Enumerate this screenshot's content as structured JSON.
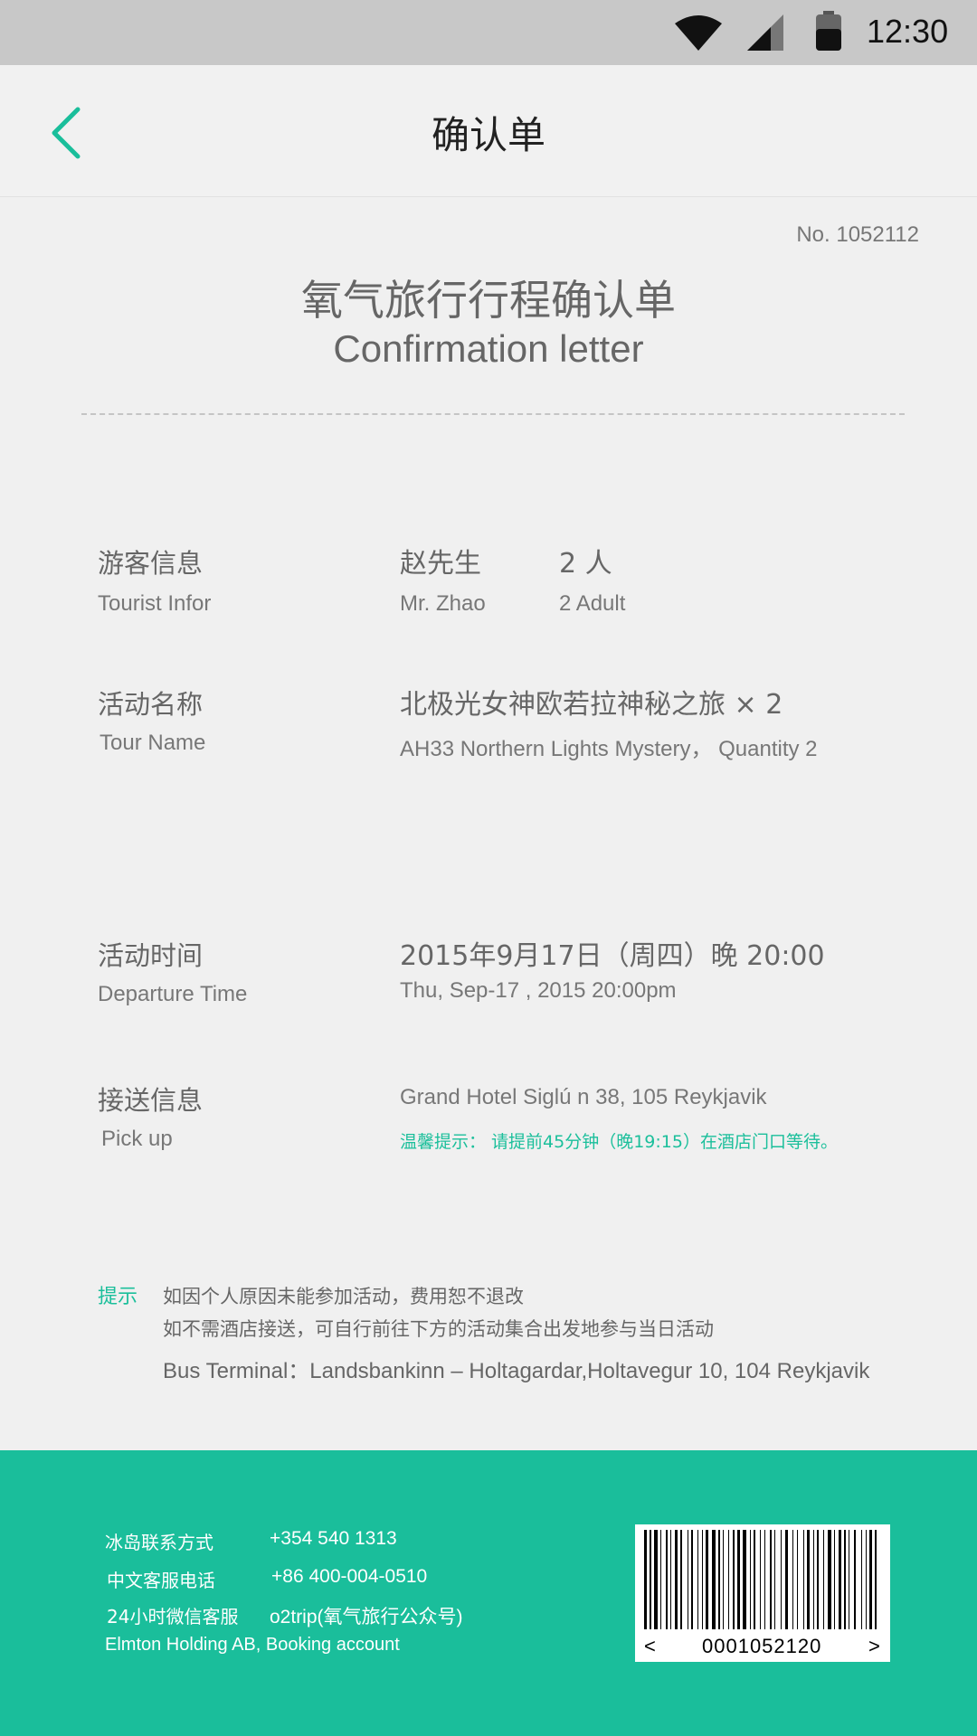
{
  "status_bar": {
    "time": "12:30"
  },
  "header": {
    "title": "确认单"
  },
  "document": {
    "number": "No. 1052112",
    "title_cn": "氧气旅行行程确认单",
    "title_en": "Confirmation letter"
  },
  "tourist": {
    "label_cn": "游客信息",
    "label_en": "Tourist Infor",
    "name_cn": "赵先生",
    "count_cn": "2 人",
    "name_en": "Mr. Zhao",
    "count_en": "2  Adult"
  },
  "tour": {
    "label_cn": "活动名称",
    "label_en": "Tour Name",
    "value_cn": "北极光女神欧若拉神秘之旅 × 2",
    "value_en": "AH33 Northern Lights Mystery，  Quantity 2"
  },
  "departure": {
    "label_cn": "活动时间",
    "label_en": "Departure Time",
    "value_cn": "2015年9月17日（周四）晚 20:00",
    "value_en": "Thu, Sep-17 , 2015  20:00pm"
  },
  "pickup": {
    "label_cn": "接送信息",
    "label_en": "Pick up",
    "address": "Grand Hotel Siglú n 38, 105 Reykjavik",
    "note": "温馨提示： 请提前45分钟（晚19:15）在酒店门口等待。"
  },
  "tips": {
    "label": "提示",
    "line1": "如因个人原因未能参加活动，费用恕不退改",
    "line2": "如不需酒店接送，可自行前往下方的活动集合出发地参与当日活动",
    "line3": "Bus Terminal：Landsbankinn – Holtagardar,Holtavegur 10, 104 Reykjavik"
  },
  "footer": {
    "contacts": [
      {
        "label": "冰岛联系方式",
        "value": "+354 540 1313"
      },
      {
        "label": "中文客服电话",
        "value": "+86 400-004-0510"
      },
      {
        "label": "24小时微信客服",
        "value": "o2trip(氧气旅行公众号)"
      }
    ],
    "company": "Elmton Holding AB, Booking account",
    "barcode": {
      "left": "<",
      "number": "0001052120",
      "right": ">"
    }
  },
  "colors": {
    "accent": "#1abe9b",
    "status_bar": "#c8c8c8",
    "background": "#f0f0f0"
  },
  "icons": {
    "back": "chevron-left-icon",
    "wifi": "wifi-icon",
    "signal": "signal-icon",
    "battery": "battery-icon"
  }
}
